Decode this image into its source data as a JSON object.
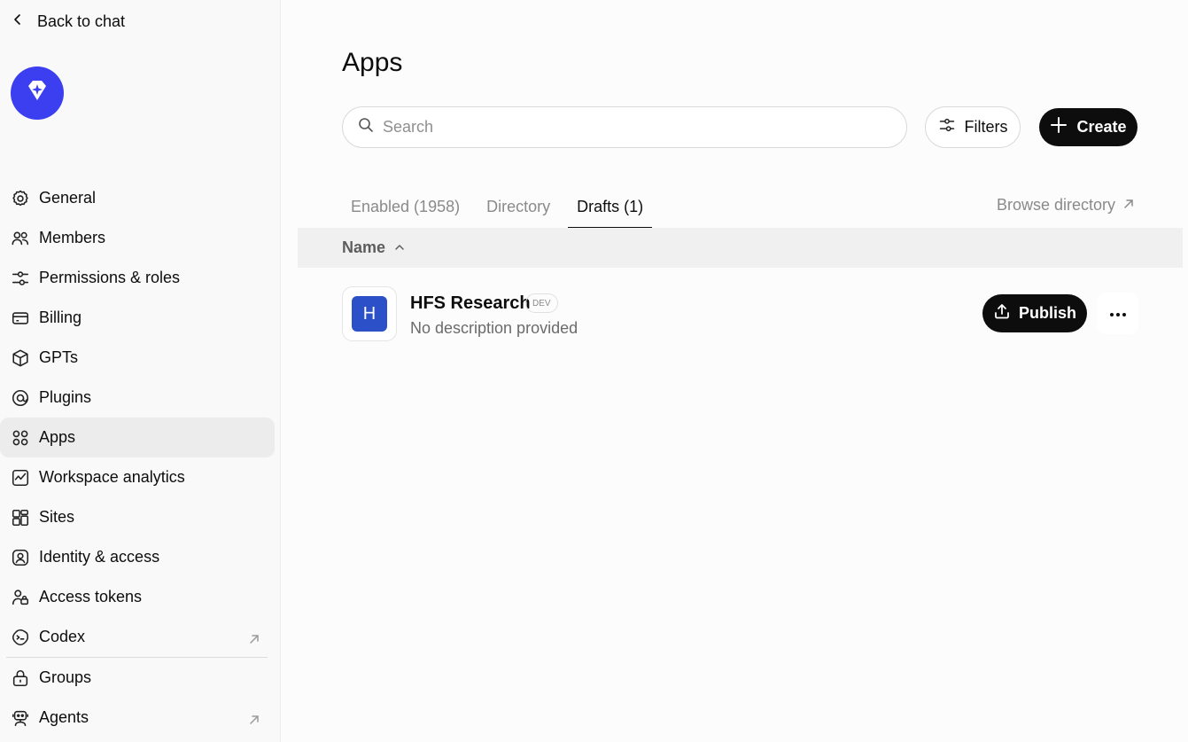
{
  "sidebar": {
    "back_label": "Back to chat",
    "logo_icon": "gem-icon",
    "accent_color": "#3c3ff0",
    "items": [
      {
        "label": "General",
        "icon": "gear-icon"
      },
      {
        "label": "Members",
        "icon": "users-icon"
      },
      {
        "label": "Permissions & roles",
        "icon": "sliders-icon"
      },
      {
        "label": "Billing",
        "icon": "credit-card-icon"
      },
      {
        "label": "GPTs",
        "icon": "cube-icon"
      },
      {
        "label": "Plugins",
        "icon": "plugin-icon"
      },
      {
        "label": "Apps",
        "icon": "apps-icon",
        "active": true
      },
      {
        "label": "Workspace analytics",
        "icon": "analytics-icon"
      },
      {
        "label": "Sites",
        "icon": "sites-icon"
      },
      {
        "label": "Identity & access",
        "icon": "identity-icon"
      },
      {
        "label": "Access tokens",
        "icon": "token-icon"
      },
      {
        "label": "Codex",
        "icon": "codex-icon",
        "external": true
      },
      {
        "label": "Groups",
        "icon": "lock-icon"
      },
      {
        "label": "Agents",
        "icon": "robot-icon",
        "external": true
      }
    ]
  },
  "main": {
    "title": "Apps",
    "search": {
      "placeholder": "Search",
      "value": ""
    },
    "filters_label": "Filters",
    "create_label": "Create",
    "tabs": [
      {
        "label": "Enabled (1958)",
        "active": false
      },
      {
        "label": "Directory",
        "active": false
      },
      {
        "label": "Drafts (1)",
        "active": true
      }
    ],
    "browse_label": "Browse directory",
    "table": {
      "name_header": "Name",
      "rows": [
        {
          "initial": "H",
          "name": "HFS Research",
          "badge": "DEV",
          "description": "No description provided",
          "publish_label": "Publish"
        }
      ]
    }
  }
}
